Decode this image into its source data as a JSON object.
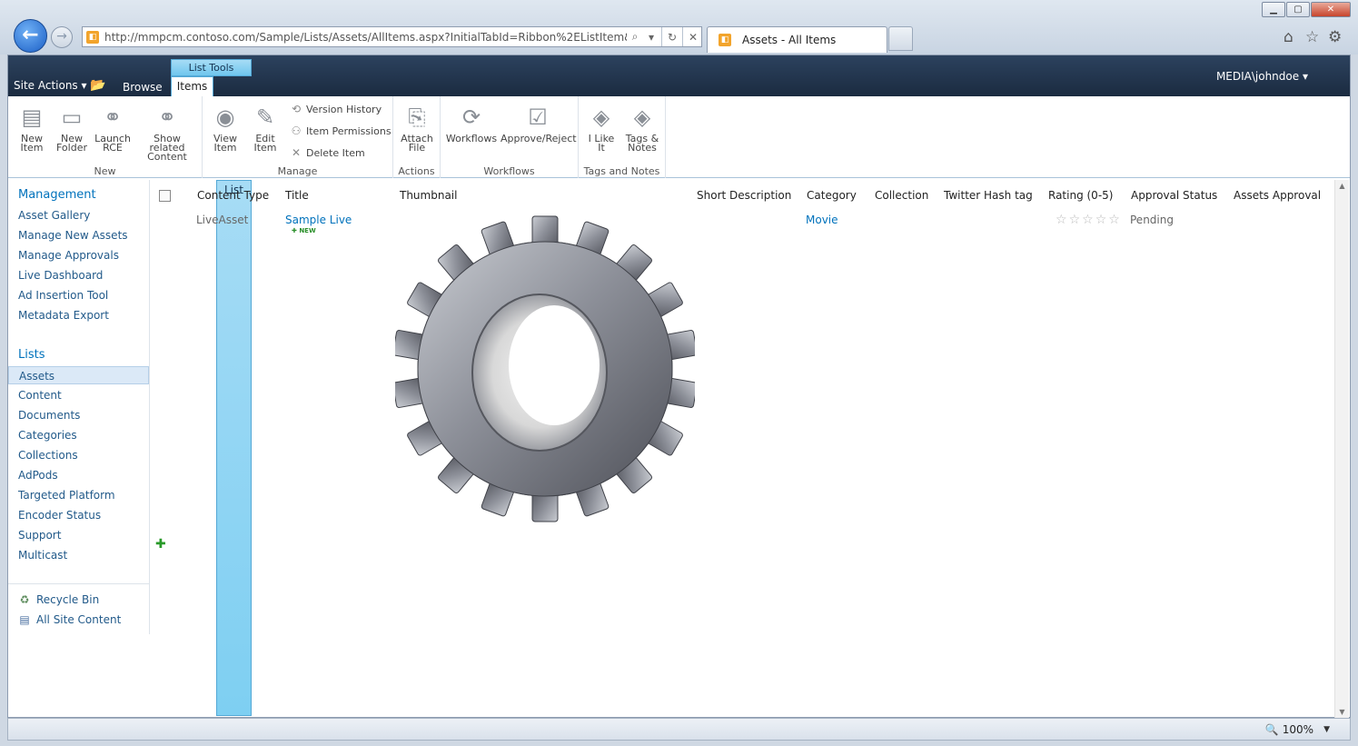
{
  "browser": {
    "url": "http://mmpcm.contoso.com/Sample/Lists/Assets/AllItems.aspx?InitialTabId=Ribbon%2EListItem&VisibilityC",
    "tab_title": "Assets - All Items",
    "zoom": "100%"
  },
  "topbar": {
    "site_actions": "Site Actions",
    "browse": "Browse",
    "context_group": "List Tools",
    "tab_items": "Items",
    "tab_list": "List",
    "user": "MEDIA\\johndoe"
  },
  "ribbon": {
    "new_group": "New",
    "new_item": "New Item",
    "new_folder": "New Folder",
    "launch_rce": "Launch RCE",
    "show_related": "Show related Content",
    "manage_group": "Manage",
    "view_item": "View Item",
    "edit_item": "Edit Item",
    "version_history": "Version History",
    "item_permissions": "Item Permissions",
    "delete_item": "Delete Item",
    "actions_group": "Actions",
    "attach_file": "Attach File",
    "workflows_group": "Workflows",
    "workflows": "Workflows",
    "approve_reject": "Approve/Reject",
    "tags_group": "Tags and Notes",
    "i_like_it": "I Like It",
    "tags_notes": "Tags & Notes"
  },
  "leftnav": {
    "management_heading": "Management",
    "management": [
      "Asset Gallery",
      "Manage New Assets",
      "Manage Approvals",
      "Live Dashboard",
      "Ad Insertion Tool",
      "Metadata Export"
    ],
    "lists_heading": "Lists",
    "lists": [
      "Assets",
      "Content",
      "Documents",
      "Categories",
      "Collections",
      "AdPods",
      "Targeted Platform",
      "Encoder Status",
      "Support",
      "Multicast"
    ],
    "recycle_bin": "Recycle Bin",
    "all_site_content": "All Site Content"
  },
  "table": {
    "columns": [
      "Content Type",
      "Title",
      "Thumbnail",
      "Short Description",
      "Category",
      "Collection",
      "Twitter Hash tag",
      "Rating (0-5)",
      "Approval Status",
      "Assets Approval"
    ],
    "rows": [
      {
        "content_type": "LiveAsset",
        "title": "Sample Live",
        "new_badge": "NEW",
        "category": "Movie",
        "rating": 0,
        "approval_status": "Pending"
      }
    ]
  },
  "colors": {
    "topbar": "#1b2b40",
    "link": "#0072bc",
    "context_tab": "#7ecff2"
  }
}
